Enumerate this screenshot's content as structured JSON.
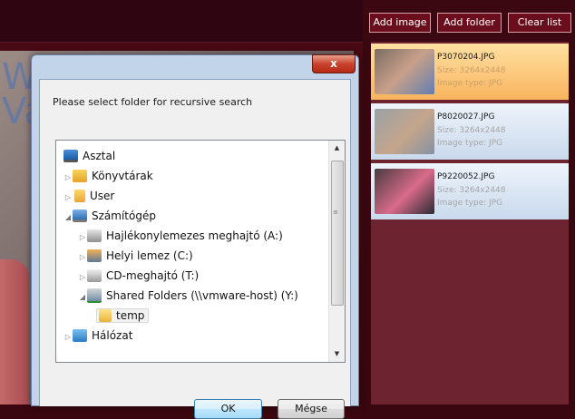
{
  "toolbar": {
    "add_image": "Add image",
    "add_folder": "Add folder",
    "clear_list": "Clear list"
  },
  "images": [
    {
      "name": "P3070204.JPG",
      "size": "Size: 3264x2448",
      "type": "Image type: JPG",
      "selected": true
    },
    {
      "name": "P8020027.JPG",
      "size": "Size: 3264x2448",
      "type": "Image type: JPG",
      "selected": false
    },
    {
      "name": "P9220052.JPG",
      "size": "Size: 3264x2448",
      "type": "Image type: JPG",
      "selected": false
    }
  ],
  "dialog": {
    "close_glyph": "x",
    "prompt": "Please select folder for recursive search",
    "tree": [
      {
        "label": "Asztal",
        "icon": "desktop-icon"
      },
      {
        "label": "Könyvtárak",
        "icon": "library-icon"
      },
      {
        "label": "User",
        "icon": "user-folder-icon"
      },
      {
        "label": "Számítógép",
        "icon": "computer-icon"
      },
      {
        "label": "Hajlékonylemezes meghajtó (A:)",
        "icon": "floppy-drive-icon"
      },
      {
        "label": "Helyi lemez (C:)",
        "icon": "hard-drive-icon"
      },
      {
        "label": "CD-meghajtó (T:)",
        "icon": "cd-drive-icon"
      },
      {
        "label": "Shared Folders (\\\\vmware-host) (Y:)",
        "icon": "network-drive-icon"
      },
      {
        "label": "temp",
        "icon": "folder-icon",
        "selected": true
      },
      {
        "label": "Hálózat",
        "icon": "network-icon"
      }
    ],
    "ok_label": "OK",
    "cancel_label": "Mégse"
  },
  "background": {
    "line1": "W",
    "line2": "Va"
  }
}
